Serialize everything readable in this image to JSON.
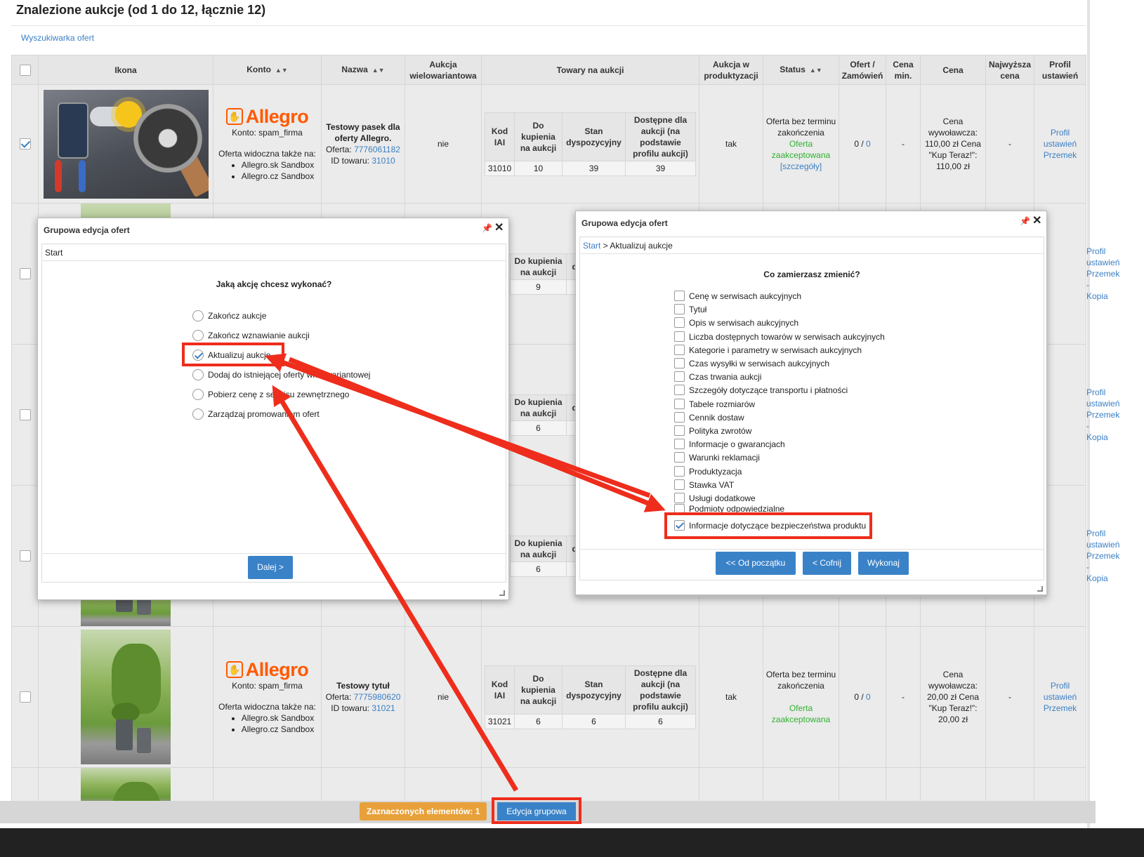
{
  "page": {
    "title": "Znalezione aukcje (od 1 do 12, łącznie 12)",
    "search_link": "Wyszukiwarka ofert"
  },
  "table": {
    "headers": {
      "icon": "Ikona",
      "account": "Konto",
      "name": "Nazwa",
      "multivariant": "Aukcja wielowariantowa",
      "goods": "Towary na aukcji",
      "in_production": "Aukcja w produktyzacji",
      "status": "Status",
      "offers_orders": "Ofert / Zamówień",
      "min_price": "Cena min.",
      "price": "Cena",
      "highest_price": "Najwyższa cena",
      "profile": "Profil ustawień"
    },
    "inner_headers": {
      "code": "Kod IAI",
      "to_buy": "Do kupienia na aukcji",
      "stock": "Stan dyspozycyjny",
      "available": "Dostępne dla aukcji (na podstawie profilu aukcji)"
    },
    "inner_headers_partial": {
      "to_buy": "Do kupienia na aukcji",
      "stock_cut": "dy"
    },
    "brand": "Allegro",
    "row1": {
      "account_line": "Konto: spam_firma",
      "visible_also": "Oferta widoczna także na:",
      "sites": [
        "Allegro.sk Sandbox",
        "Allegro.cz Sandbox"
      ],
      "name_title": "Testowy pasek dla oferty Allegro.",
      "offer_label": "Oferta:",
      "offer_id": "7776061182",
      "product_label": "ID towaru:",
      "product_id": "31010",
      "multivariant": "nie",
      "code": "31010",
      "to_buy": "10",
      "stock": "39",
      "available": "39",
      "in_production": "tak",
      "status_line": "Oferta bez terminu zakończenia",
      "status_accepted": "Oferta zaakceptowana",
      "status_details": "[szczegóły]",
      "offers_orders_a": "0 /",
      "offers_orders_b": "0",
      "min_price": "-",
      "price_text": "Cena wywoławcza: 110,00 zł Cena \"Kup Teraz!\": 110,00 zł",
      "highest": "-",
      "profile": "Profil ustawień Przemek"
    },
    "hidden_rows": [
      {
        "to_buy": "9",
        "profile": "Profil ustawień Przemek - Kopia"
      },
      {
        "to_buy": "6",
        "profile": "Profil ustawień Przemek - Kopia"
      },
      {
        "to_buy": "6",
        "profile": "Profil ustawień Przemek - Kopia"
      }
    ],
    "row5": {
      "account_line": "Konto: spam_firma",
      "visible_also": "Oferta widoczna także na:",
      "sites": [
        "Allegro.sk Sandbox",
        "Allegro.cz Sandbox"
      ],
      "name_title": "Testowy tytuł",
      "offer_label": "Oferta:",
      "offer_id": "7775980620",
      "product_label": "ID towaru:",
      "product_id": "31021",
      "multivariant": "nie",
      "code": "31021",
      "to_buy": "6",
      "stock": "6",
      "available": "6",
      "in_production": "tak",
      "status_line": "Oferta bez terminu zakończenia",
      "status_accepted": "Oferta zaakceptowana",
      "offers_orders_a": "0 /",
      "offers_orders_b": "0",
      "min_price": "-",
      "price_text": "Cena wywoławcza: 20,00 zł Cena \"Kup Teraz!\": 20,00 zł",
      "highest": "-",
      "profile": "Profil ustawień Przemek"
    }
  },
  "dialog_left": {
    "title": "Grupowa edycja ofert",
    "breadcrumb": "Start",
    "question": "Jaką akcję chcesz wykonać?",
    "options": [
      {
        "label": "Zakończ aukcje",
        "checked": false
      },
      {
        "label": "Zakończ wznawianie aukcji",
        "checked": false
      },
      {
        "label": "Aktualizuj aukcje",
        "checked": true
      },
      {
        "label": "Dodaj do istniejącej oferty wielowariantowej",
        "checked": false
      },
      {
        "label": "Pobierz cenę z serwisu zewnętrznego",
        "checked": false
      },
      {
        "label": "Zarządzaj promowaniem ofert",
        "checked": false
      }
    ],
    "next_button": "Dalej >"
  },
  "dialog_right": {
    "title": "Grupowa edycja ofert",
    "breadcrumb_link": "Start",
    "breadcrumb_rest": " > Aktualizuj aukcje",
    "question": "Co zamierzasz zmienić?",
    "options": [
      {
        "label": "Cenę w serwisach aukcyjnych",
        "checked": false
      },
      {
        "label": "Tytuł",
        "checked": false
      },
      {
        "label": "Opis w serwisach aukcyjnych",
        "checked": false
      },
      {
        "label": "Liczba dostępnych towarów w serwisach aukcyjnych",
        "checked": false
      },
      {
        "label": "Kategorie i parametry w serwisach aukcyjnych",
        "checked": false
      },
      {
        "label": "Czas wysyłki w serwisach aukcyjnych",
        "checked": false
      },
      {
        "label": "Czas trwania aukcji",
        "checked": false
      },
      {
        "label": "Szczegóły dotyczące transportu i płatności",
        "checked": false
      },
      {
        "label": "Tabele rozmiarów",
        "checked": false
      },
      {
        "label": "Cennik dostaw",
        "checked": false
      },
      {
        "label": "Polityka zwrotów",
        "checked": false
      },
      {
        "label": "Informacje o gwarancjach",
        "checked": false
      },
      {
        "label": "Warunki reklamacji",
        "checked": false
      },
      {
        "label": "Produktyzacja",
        "checked": false
      },
      {
        "label": "Stawka VAT",
        "checked": false
      },
      {
        "label": "Usługi dodatkowe",
        "checked": false
      },
      {
        "label": "Podmioty odpowiedzialne",
        "checked": false
      },
      {
        "label": "Informacje dotyczące bezpieczeństwa produktu",
        "checked": true
      }
    ],
    "buttons": {
      "restart": "<< Od początku",
      "back": "< Cofnij",
      "execute": "Wykonaj"
    }
  },
  "bottom": {
    "selected_label": "Zaznaczonych elementów: 1",
    "group_edit_button": "Edycja grupowa"
  },
  "colors": {
    "link": "#3b7fc4",
    "accent_button": "#3a82c8",
    "allegro_orange": "#ff5a00",
    "accepted_green": "#31b131",
    "highlight_red": "#ee2d1c",
    "badge_orange": "#e8a13a"
  }
}
